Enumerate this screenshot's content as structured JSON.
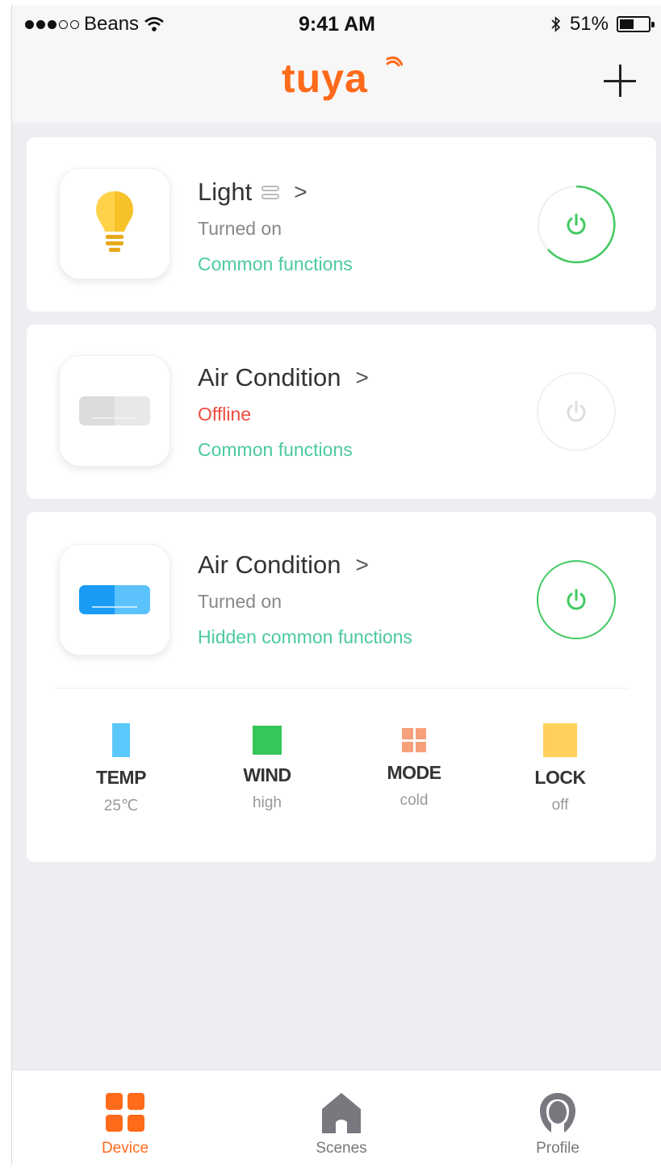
{
  "status_bar": {
    "carrier": "Beans",
    "time": "9:41 AM",
    "battery": "51%",
    "battery_level": 0.51
  },
  "header": {
    "logo": "tuya",
    "add_icon": "plus-icon"
  },
  "devices": [
    {
      "name": "Light",
      "status": "Turned on",
      "functions_link": "Common functions",
      "icon": "bulb-icon",
      "power": "on"
    },
    {
      "name": "Air Condition",
      "status": "Offline",
      "functions_link": "Common functions",
      "icon": "air-conditioner-icon",
      "power": "offline"
    },
    {
      "name": "Air Condition",
      "status": "Turned on",
      "functions_link": "Hidden common functions",
      "icon": "air-conditioner-icon",
      "power": "on",
      "functions": [
        {
          "label": "TEMP",
          "value": "25℃",
          "color": "#5ac8fa"
        },
        {
          "label": "WIND",
          "value": "high",
          "color": "#35c759"
        },
        {
          "label": "MODE",
          "value": "cold",
          "color": "#f5a07a"
        },
        {
          "label": "LOCK",
          "value": "off",
          "color": "#ffd15c"
        }
      ]
    }
  ],
  "tabs": [
    {
      "label": "Device",
      "icon": "grid-icon",
      "active": true
    },
    {
      "label": "Scenes",
      "icon": "home-icon",
      "active": false
    },
    {
      "label": "Profile",
      "icon": "profile-icon",
      "active": false
    }
  ],
  "colors": {
    "brand": "#ff6a1b",
    "accent_green": "#41c960",
    "link": "#4cc9a0",
    "offline": "#ef4b3f"
  }
}
